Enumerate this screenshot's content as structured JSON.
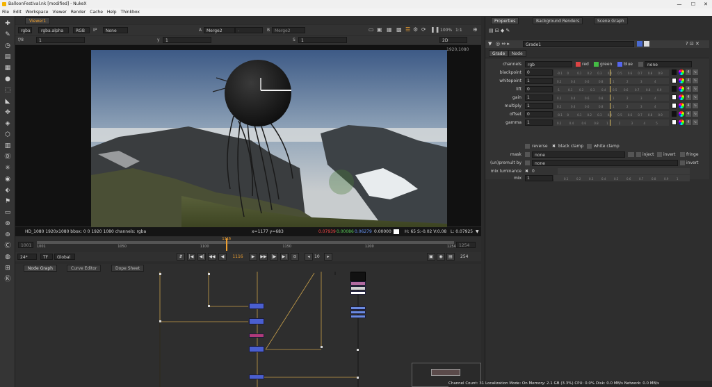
{
  "window": {
    "title": "BalloonFestival.nk [modified] - NukeX",
    "controls": [
      "—",
      "☐",
      "✕"
    ]
  },
  "menu": [
    "File",
    "Edit",
    "Workspace",
    "Viewer",
    "Render",
    "Cache",
    "Help",
    "Thinkbox"
  ],
  "viewer": {
    "tab": "Viewer1",
    "channels": "rgba",
    "alpha": "rgba.alpha",
    "colorspace": "RGB",
    "ip_label": "IP",
    "none_label": "None",
    "a_label": "A",
    "a_input": "Merge2",
    "a_op": "-",
    "b_label": "B",
    "b_input": "Merge2",
    "zoom": "100%",
    "ratio": "1:1",
    "fstop": "f/8",
    "gain_val": "1",
    "y_label": "y",
    "y_val": "1",
    "s_label": "S",
    "s_val": "1",
    "mode": "2D",
    "resolution_tag": "1920,1080"
  },
  "infobar": {
    "format": "HD_1080 1920x1080  bbox: 0 0 1920 1080 channels: rgba",
    "coords": "x=1177 y=683",
    "r": "0.07939",
    "g": "0.00086",
    "b": "0.06279",
    "a": "0.00000",
    "hsv": "H: 65 S:-0.02 V:0.08",
    "l": "L: 0.07925"
  },
  "timeline": {
    "start": "1001",
    "end": "1254",
    "current": "1116",
    "ticks": [
      "1001",
      "1050",
      "1100",
      "1150",
      "1200",
      "1254"
    ],
    "current_fraction": 0.454
  },
  "playback": {
    "fps": "24*",
    "tf": "TF",
    "scope": "Global",
    "frame": "1116",
    "step": "10",
    "range_end": "254"
  },
  "graph_tabs": [
    "Node Graph",
    "Curve Editor",
    "Dope Sheet"
  ],
  "panel_tabs": [
    "Properties",
    "Background Renders",
    "Scene Graph"
  ],
  "properties": {
    "node_name": "Grade1",
    "subtabs": [
      "Grade",
      "Node"
    ],
    "channels_label": "channels",
    "channels_value": "rgb",
    "channel_checks": [
      "red",
      "green",
      "blue"
    ],
    "channel_extra": "none",
    "params": [
      {
        "name": "blackpoint",
        "value": "0",
        "ticks": [
          "-0.1",
          "0",
          "0.1",
          "0.2",
          "0.3",
          "0.4",
          "0.5",
          "0.6",
          "0.7",
          "0.8",
          "0.9"
        ],
        "swatch": "#111111"
      },
      {
        "name": "whitepoint",
        "value": "1",
        "ticks": [
          "0.2",
          "0.4",
          "0.6",
          "0.8",
          "1",
          "2",
          "3",
          "4"
        ],
        "swatch": "#ffffff"
      },
      {
        "name": "lift",
        "value": "0",
        "ticks": [
          "-1",
          "0.1",
          "0.2",
          "0.3",
          "0.4",
          "0.5",
          "0.6",
          "0.7",
          "0.8",
          "0.9"
        ],
        "swatch": "#111111"
      },
      {
        "name": "gain",
        "value": "1",
        "ticks": [
          "0.2",
          "0.4",
          "0.6",
          "0.8",
          "1",
          "2",
          "3",
          "4"
        ],
        "swatch": "#ffffff"
      },
      {
        "name": "multiply",
        "value": "1",
        "ticks": [
          "0.2",
          "0.4",
          "0.6",
          "0.8",
          "1",
          "2",
          "3",
          "4"
        ],
        "swatch": "#ffffff"
      },
      {
        "name": "offset",
        "value": "0",
        "ticks": [
          "-0.1",
          "0",
          "0.1",
          "0.2",
          "0.3",
          "0.4",
          "0.5",
          "0.6",
          "0.7",
          "0.8",
          "0.9"
        ],
        "swatch": "#111111"
      },
      {
        "name": "gamma",
        "value": "1",
        "ticks": [
          "0.2",
          "0.4",
          "0.6",
          "0.8",
          "1",
          "2",
          "3",
          "4",
          "5"
        ],
        "swatch": "#ffffff"
      }
    ],
    "clamp_options": [
      "reverse",
      "black clamp",
      "white clamp"
    ],
    "mask_label": "mask",
    "mask_value": "none",
    "mask_options": [
      "inject",
      "invert",
      "fringe"
    ],
    "premult_label": "(un)premult by",
    "premult_value": "none",
    "premult_invert": "invert",
    "mixlum_label": "mix luminance",
    "mixlum_value": "0",
    "mix_label": "mix",
    "mix_value": "1",
    "mix_ticks": [
      "0.1",
      "0.2",
      "0.3",
      "0.4",
      "0.5",
      "0.6",
      "0.7",
      "0.8",
      "0.9",
      "1"
    ]
  },
  "status": "Channel Count: 31  Localization Mode: On  Memory: 2.1 GB (3.3%)  CPU: 0.0%  Disk: 0.0 MB/s  Network: 0.0 MB/s",
  "colors": {
    "accent": "#f0a030",
    "node_blue": "#4a5fd0",
    "node_pink": "#b03a7a",
    "mask_yellow": "#c8a04a"
  }
}
